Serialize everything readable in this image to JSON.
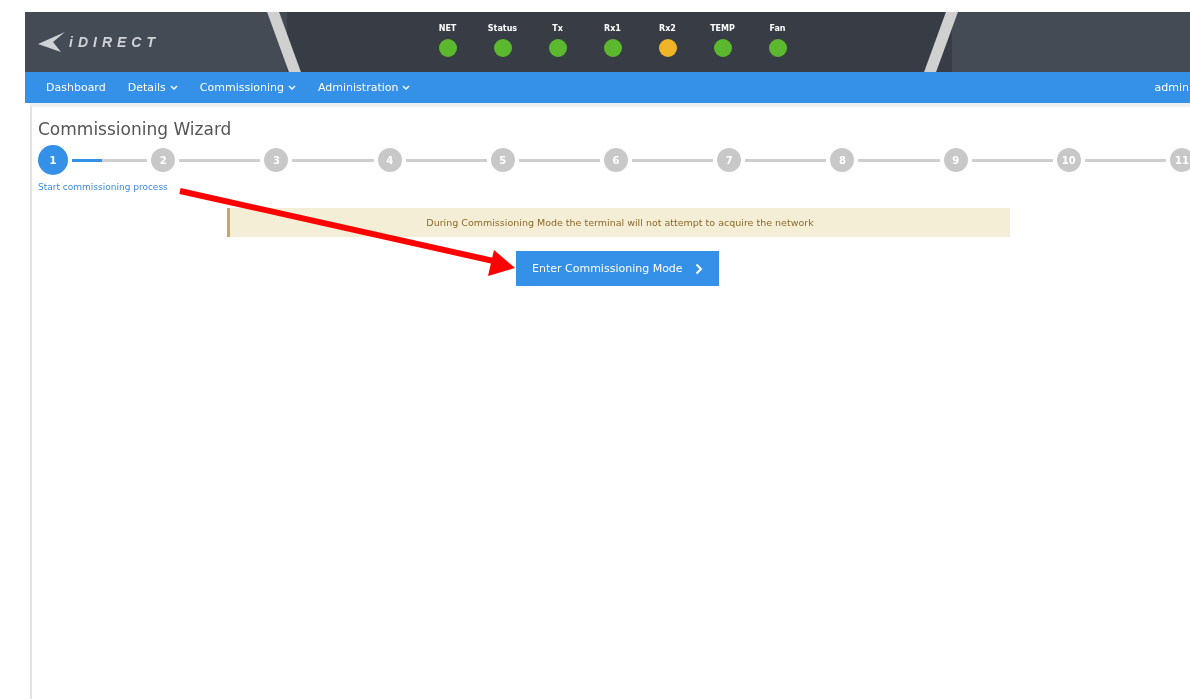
{
  "header": {
    "logo": "iDIRECT",
    "indicators": [
      {
        "label": "NET",
        "color": "#5cb82e"
      },
      {
        "label": "Status",
        "color": "#5cb82e"
      },
      {
        "label": "Tx",
        "color": "#5cb82e"
      },
      {
        "label": "Rx1",
        "color": "#5cb82e"
      },
      {
        "label": "Rx2",
        "color": "#f0b429"
      },
      {
        "label": "TEMP",
        "color": "#5cb82e"
      },
      {
        "label": "Fan",
        "color": "#5cb82e"
      }
    ]
  },
  "nav": {
    "items": [
      {
        "label": "Dashboard",
        "dropdown": false
      },
      {
        "label": "Details",
        "dropdown": true
      },
      {
        "label": "Commissioning",
        "dropdown": true
      },
      {
        "label": "Administration",
        "dropdown": true
      }
    ],
    "user": "admin"
  },
  "wizard": {
    "title": "Commissioning Wizard",
    "steps": [
      {
        "label": "1",
        "selected": true,
        "caption": "Start commissioning process"
      },
      {
        "label": "2",
        "selected": false
      },
      {
        "label": "3",
        "selected": false
      },
      {
        "label": "4",
        "selected": false
      },
      {
        "label": "5",
        "selected": false
      },
      {
        "label": "6",
        "selected": false
      },
      {
        "label": "7",
        "selected": false
      },
      {
        "label": "8",
        "selected": false
      },
      {
        "label": "9",
        "selected": false
      },
      {
        "label": "10",
        "selected": false
      },
      {
        "label": "11",
        "selected": false
      }
    ],
    "notice": "During Commissioning Mode the terminal will not attempt to acquire the network",
    "button": "Enter Commissioning Mode"
  }
}
